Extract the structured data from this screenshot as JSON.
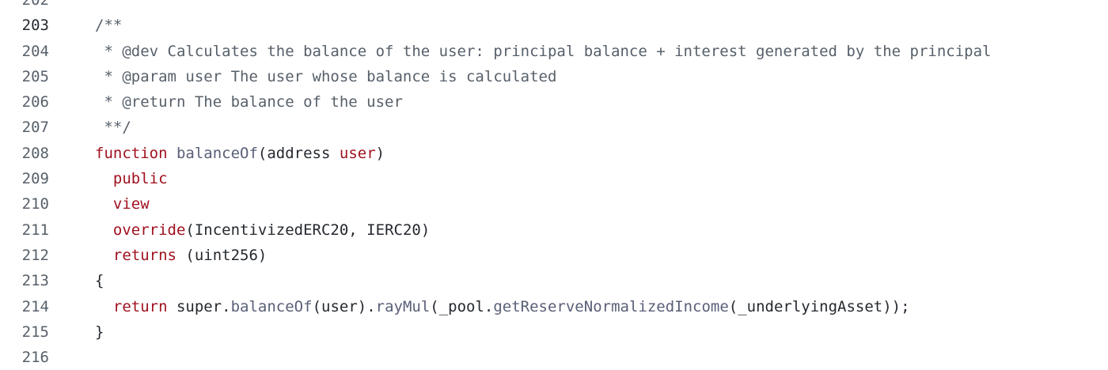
{
  "editor": {
    "current_line": 203,
    "lines": [
      {
        "number": "202",
        "tokens": []
      },
      {
        "number": "203",
        "tokens": [
          {
            "t": "/**",
            "k": "comment"
          }
        ]
      },
      {
        "number": "204",
        "tokens": [
          {
            "t": " * @dev Calculates the balance of the user: principal balance + interest generated by the principal",
            "k": "comment"
          }
        ]
      },
      {
        "number": "205",
        "tokens": [
          {
            "t": " * @param user The user whose balance is calculated",
            "k": "comment"
          }
        ]
      },
      {
        "number": "206",
        "tokens": [
          {
            "t": " * @return The balance of the user",
            "k": "comment"
          }
        ]
      },
      {
        "number": "207",
        "tokens": [
          {
            "t": " **/",
            "k": "comment"
          }
        ]
      },
      {
        "number": "208",
        "tokens": [
          {
            "t": "function",
            "k": "keyword"
          },
          {
            "t": " ",
            "k": "plain"
          },
          {
            "t": "balanceOf",
            "k": "func"
          },
          {
            "t": "(address ",
            "k": "plain"
          },
          {
            "t": "user",
            "k": "keyword"
          },
          {
            "t": ")",
            "k": "plain"
          }
        ]
      },
      {
        "number": "209",
        "tokens": [
          {
            "t": "  ",
            "k": "plain"
          },
          {
            "t": "public",
            "k": "keyword"
          }
        ]
      },
      {
        "number": "210",
        "tokens": [
          {
            "t": "  ",
            "k": "plain"
          },
          {
            "t": "view",
            "k": "keyword"
          }
        ]
      },
      {
        "number": "211",
        "tokens": [
          {
            "t": "  ",
            "k": "plain"
          },
          {
            "t": "override",
            "k": "keyword"
          },
          {
            "t": "(IncentivizedERC20, IERC20)",
            "k": "plain"
          }
        ]
      },
      {
        "number": "212",
        "tokens": [
          {
            "t": "  ",
            "k": "plain"
          },
          {
            "t": "returns",
            "k": "keyword"
          },
          {
            "t": " (uint256)",
            "k": "plain"
          }
        ]
      },
      {
        "number": "213",
        "tokens": [
          {
            "t": "{",
            "k": "plain"
          }
        ]
      },
      {
        "number": "214",
        "tokens": [
          {
            "t": "  ",
            "k": "plain"
          },
          {
            "t": "return",
            "k": "keyword"
          },
          {
            "t": " super.",
            "k": "plain"
          },
          {
            "t": "balanceOf",
            "k": "func"
          },
          {
            "t": "(user).",
            "k": "plain"
          },
          {
            "t": "rayMul",
            "k": "func"
          },
          {
            "t": "(_pool.",
            "k": "plain"
          },
          {
            "t": "getReserveNormalizedIncome",
            "k": "func"
          },
          {
            "t": "(_underlyingAsset));",
            "k": "plain"
          }
        ]
      },
      {
        "number": "215",
        "tokens": [
          {
            "t": "}",
            "k": "plain"
          }
        ]
      },
      {
        "number": "216",
        "tokens": []
      }
    ]
  }
}
